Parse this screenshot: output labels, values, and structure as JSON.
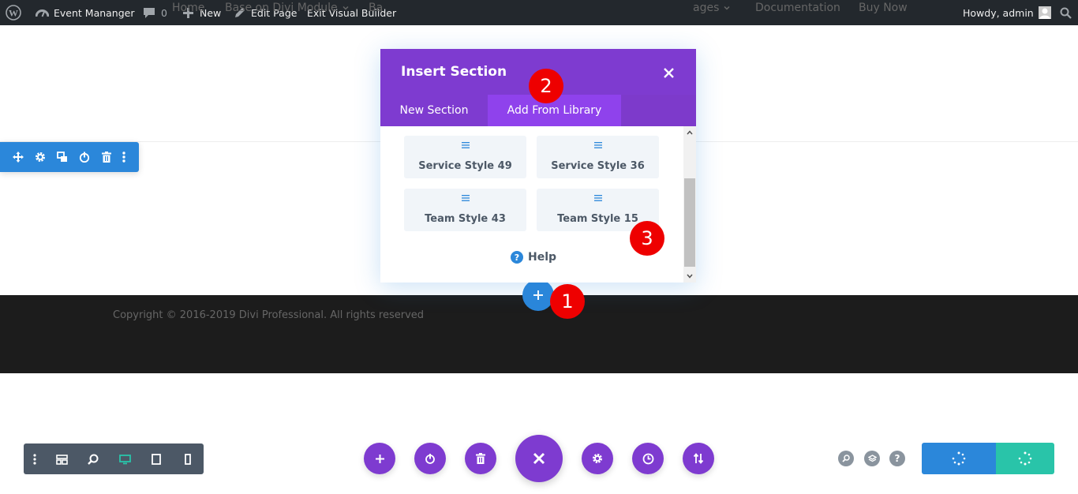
{
  "admin_bar": {
    "site_name": "Event Mananger",
    "comments_count": "0",
    "new_label": "New",
    "edit_label": "Edit Page",
    "exit_label": "Exit Visual Builder",
    "greeting": "Howdy, admin"
  },
  "nav": {
    "items": [
      "Home",
      "Base on Divi Module",
      "Ba",
      "ages",
      "Documentation",
      "Buy Now"
    ]
  },
  "modal": {
    "title": "Insert Section",
    "tabs": [
      "New Section",
      "Add From Library"
    ],
    "active_tab": "Add From Library",
    "library_items": [
      "Service Style 49",
      "Service Style 36",
      "Team Style 43",
      "Team Style 15"
    ],
    "help_label": "Help"
  },
  "footer": {
    "copyright": "Copyright © 2016-2019 Divi Professional. All rights reserved"
  },
  "markers": [
    "1",
    "2",
    "3"
  ],
  "colors": {
    "admin_bar": "#23282d",
    "divi_purple": "#7e3bd0",
    "divi_blue": "#2b87da",
    "divi_teal": "#29c4a9",
    "marker_red": "#ee0000",
    "footer": "#1c1c1c"
  }
}
